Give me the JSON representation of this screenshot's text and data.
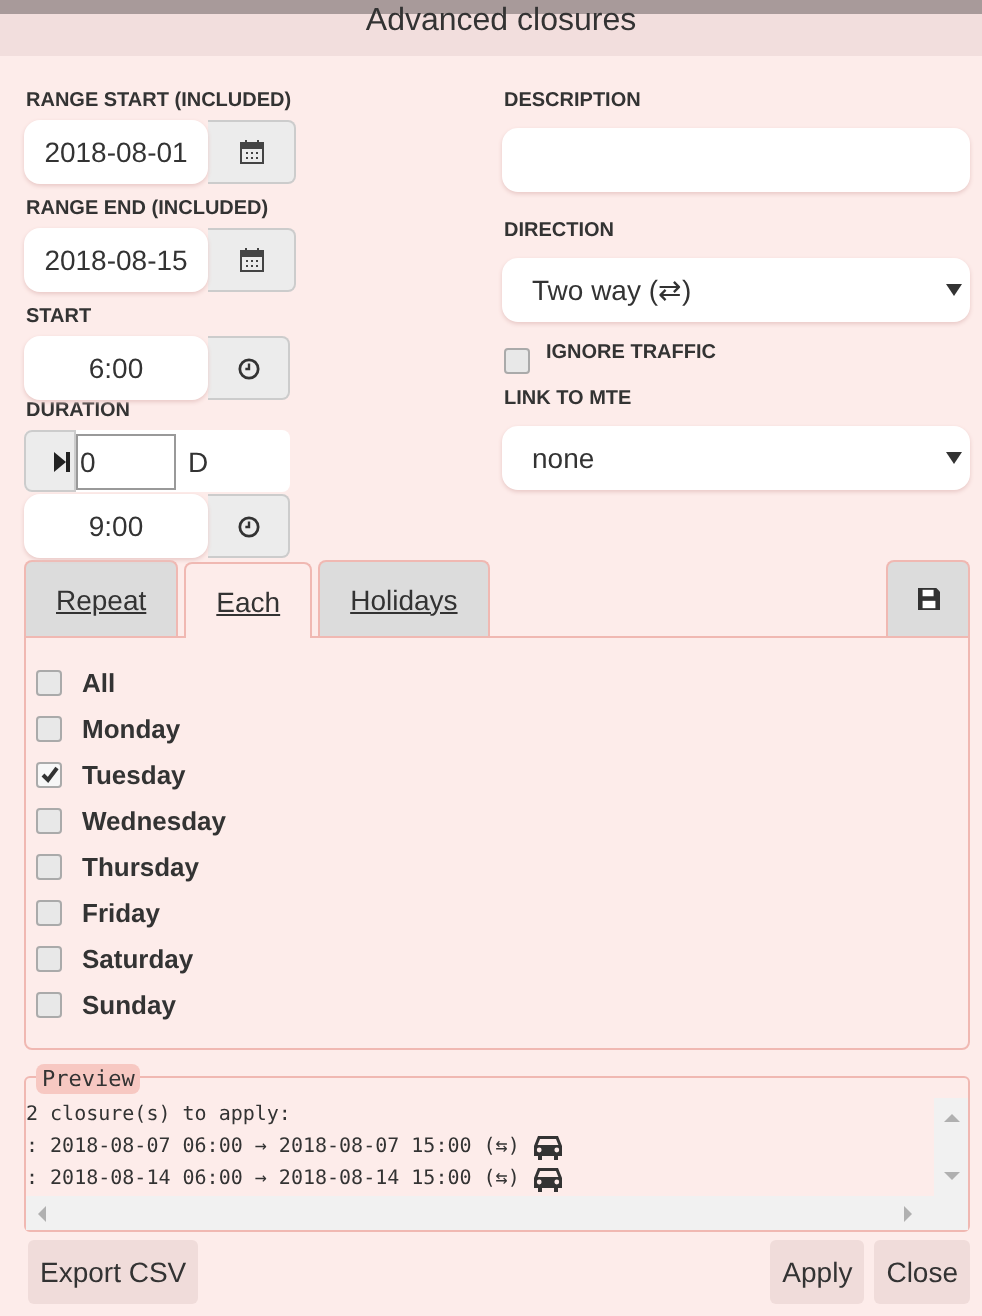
{
  "window": {
    "title": "Advanced closures"
  },
  "form": {
    "range_start": {
      "label": "RANGE START (INCLUDED)",
      "value": "2018-08-01"
    },
    "range_end": {
      "label": "RANGE END (INCLUDED)",
      "value": "2018-08-15"
    },
    "start": {
      "label": "START",
      "value": "6:00"
    },
    "duration": {
      "label": "DURATION",
      "days": "0",
      "unit": "D",
      "time": "9:00"
    },
    "description": {
      "label": "DESCRIPTION"
    },
    "direction": {
      "label": "DIRECTION",
      "value": "Two way (⇄)"
    },
    "ignore_traffic": {
      "label": "IGNORE TRAFFIC",
      "checked": false
    },
    "link_to_mte": {
      "label": "LINK TO MTE",
      "value": "none"
    }
  },
  "tabs": [
    {
      "label": "Repeat",
      "selected": false
    },
    {
      "label": "Each",
      "selected": true
    },
    {
      "label": "Holidays",
      "selected": false
    }
  ],
  "days": [
    {
      "label": "All",
      "checked": false
    },
    {
      "label": "Monday",
      "checked": false
    },
    {
      "label": "Tuesday",
      "checked": true
    },
    {
      "label": "Wednesday",
      "checked": false
    },
    {
      "label": "Thursday",
      "checked": false
    },
    {
      "label": "Friday",
      "checked": false
    },
    {
      "label": "Saturday",
      "checked": false
    },
    {
      "label": "Sunday",
      "checked": false
    }
  ],
  "preview": {
    "legend": "Preview",
    "summary": "2 closure(s) to apply:",
    "lines": [
      ": 2018-08-07 06:00 → 2018-08-07 15:00 (⇆)",
      ": 2018-08-14 06:00 → 2018-08-14 15:00 (⇆)"
    ]
  },
  "buttons": {
    "export": "Export CSV",
    "apply": "Apply",
    "close": "Close"
  }
}
